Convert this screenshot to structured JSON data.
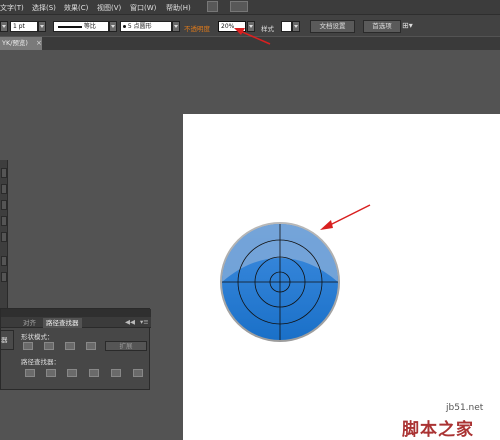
{
  "menu": {
    "items": [
      "文字(T)",
      "选择(S)",
      "效果(C)",
      "视图(V)",
      "窗口(W)",
      "帮助(H)"
    ]
  },
  "control_bar": {
    "stroke_weight": "1 pt",
    "stroke_profile": "等比",
    "brush": "5 点圆形",
    "opacity_label": "不透明度",
    "opacity_value": "20%",
    "style_label": "样式",
    "doc_setup_button": "文档设置",
    "preferences_button": "首选项"
  },
  "document_tab": {
    "label": "YK/预览)",
    "close": "×"
  },
  "pathfinder_panel": {
    "tab_align": "对齐",
    "tab_pathfinder": "路径查找器",
    "collapse": "◀◀",
    "menu": "▾≡",
    "shape_modes_label": "形状模式：",
    "expand_button": "扩展",
    "pathfinders_label": "路径查找器：",
    "side_label": "器"
  },
  "watermark": {
    "site": "jb51.net",
    "brand": "脚本之家"
  },
  "colors": {
    "opacity_label": "#e07a1a",
    "circle_fill": "#2a7fd4",
    "arrow": "#d92020"
  }
}
